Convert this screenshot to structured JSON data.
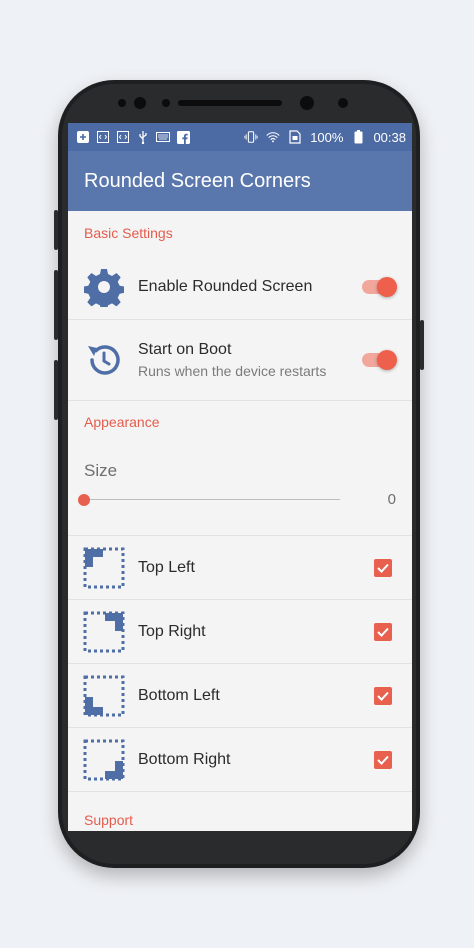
{
  "status_bar": {
    "battery": "100%",
    "time": "00:38"
  },
  "app_bar": {
    "title": "Rounded Screen Corners"
  },
  "sections": {
    "basic": "Basic Settings",
    "appearance": "Appearance",
    "support": "Support"
  },
  "settings": {
    "enable": {
      "title": "Enable Rounded Screen",
      "on": true
    },
    "boot": {
      "title": "Start on Boot",
      "subtitle": "Runs when the device restarts",
      "on": true
    }
  },
  "size": {
    "label": "Size",
    "value": "0"
  },
  "corners": [
    {
      "label": "Top Left",
      "checked": true
    },
    {
      "label": "Top Right",
      "checked": true
    },
    {
      "label": "Bottom Left",
      "checked": true
    },
    {
      "label": "Bottom Right",
      "checked": true
    }
  ],
  "colors": {
    "primary": "#5a77ad",
    "status": "#4c6aa3",
    "accent": "#e8604e"
  }
}
